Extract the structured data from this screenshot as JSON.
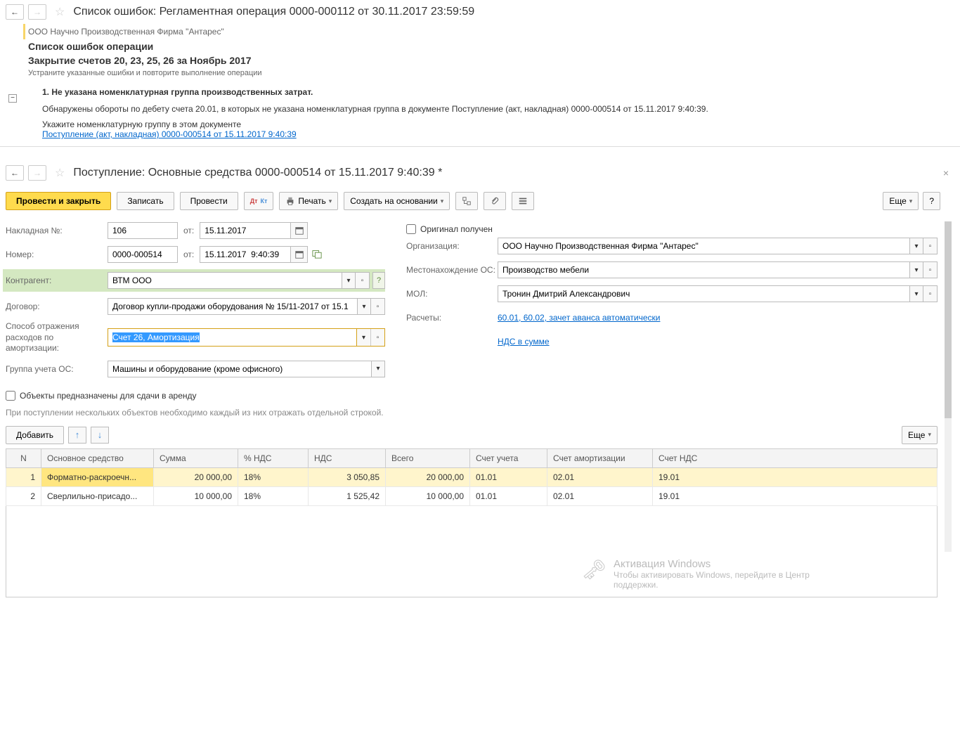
{
  "top": {
    "title": "Список ошибок: Регламентная операция 0000-000112 от 30.11.2017 23:59:59"
  },
  "errors": {
    "org": "ООО Научно Производственная Фирма \"Антарес\"",
    "heading": "Список ошибок операции",
    "subtitle": "Закрытие счетов 20, 23, 25, 26 за Ноябрь 2017",
    "instruction": "Устраните указанные ошибки и повторите выполнение операции",
    "item_heading": "1. Не указана номенклатурная группа производственных затрат.",
    "item_text": "Обнаружены обороты по дебету счета 20.01, в которых не указана номенклатурная группа в документе Поступление (акт, накладная) 0000-000514 от 15.11.2017 9:40:39.",
    "item_action": "Укажите номенклатурную группу в этом документе",
    "item_link": "Поступление (акт, накладная) 0000-000514 от 15.11.2017 9:40:39"
  },
  "doc": {
    "title": "Поступление: Основные средства 0000-000514 от 15.11.2017 9:40:39 *",
    "toolbar": {
      "post_close": "Провести и закрыть",
      "save": "Записать",
      "post": "Провести",
      "print": "Печать",
      "create_based": "Создать на основании",
      "more": "Еще",
      "help": "?"
    },
    "fields": {
      "invoice_label": "Накладная №:",
      "invoice_value": "106",
      "from_label": "от:",
      "invoice_date": "15.11.2017",
      "original_received": "Оригинал получен",
      "number_label": "Номер:",
      "number_value": "0000-000514",
      "number_datetime": "15.11.2017  9:40:39",
      "org_label": "Организация:",
      "org_value": "ООО Научно Производственная Фирма \"Антарес\"",
      "counterparty_label": "Контрагент:",
      "counterparty_value": "ВТМ ООО",
      "location_label": "Местонахождение ОС:",
      "location_value": "Производство мебели",
      "contract_label": "Договор:",
      "contract_value": "Договор купли-продажи оборудования № 15/11-2017 от 15.1",
      "mol_label": "МОЛ:",
      "mol_value": "Тронин Дмитрий Александрович",
      "amort_label": "Способ отражения расходов по амортизации:",
      "amort_value": "Счет 26, Амортизация",
      "calc_label": "Расчеты:",
      "calc_link": "60.01, 60.02, зачет аванса автоматически",
      "os_group_label": "Группа учета ОС:",
      "os_group_value": "Машины и оборудование (кроме офисного)",
      "vat_link": "НДС в сумме",
      "lease_checkbox": "Объекты предназначены для сдачи в аренду",
      "multi_note": "При поступлении нескольких объектов необходимо каждый из них отражать отдельной строкой."
    },
    "table": {
      "add_btn": "Добавить",
      "more_btn": "Еще",
      "headers": {
        "n": "N",
        "asset": "Основное средство",
        "sum": "Сумма",
        "vat_pct": "% НДС",
        "vat": "НДС",
        "total": "Всего",
        "acc": "Счет учета",
        "amort_acc": "Счет амортизации",
        "vat_acc": "Счет НДС"
      },
      "rows": [
        {
          "n": "1",
          "asset": "Форматно-раскроечн...",
          "sum": "20 000,00",
          "vat_pct": "18%",
          "vat": "3 050,85",
          "total": "20 000,00",
          "acc": "01.01",
          "amort_acc": "02.01",
          "vat_acc": "19.01"
        },
        {
          "n": "2",
          "asset": "Сверлильно-присадо...",
          "sum": "10 000,00",
          "vat_pct": "18%",
          "vat": "1 525,42",
          "total": "10 000,00",
          "acc": "01.01",
          "amort_acc": "02.01",
          "vat_acc": "19.01"
        }
      ]
    }
  },
  "watermark": {
    "title": "Активация Windows",
    "text": "Чтобы активировать Windows, перейдите в Центр поддержки."
  }
}
